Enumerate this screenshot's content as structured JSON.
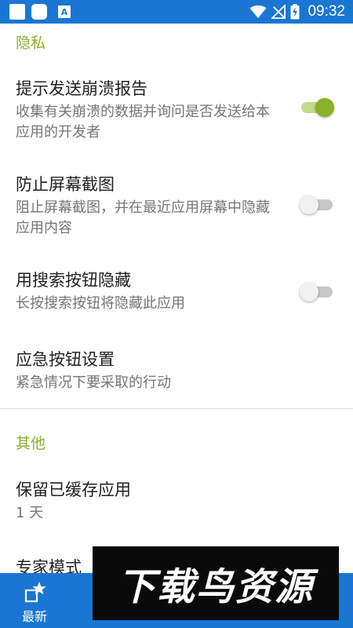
{
  "status_bar": {
    "time": "09:32",
    "notification_letter": "A",
    "icons": [
      "app-square-icon",
      "app-rounded-square-icon",
      "notification-a-icon",
      "wifi-icon",
      "no-signal-icon",
      "battery-charging-icon"
    ]
  },
  "sections": {
    "privacy": {
      "header": "隐私",
      "items": {
        "crash_report": {
          "title": "提示发送崩溃报告",
          "summary": "收集有关崩溃的数据并询问是否发送给本应用的开发者",
          "enabled": true
        },
        "prevent_screenshot": {
          "title": "防止屏幕截图",
          "summary": "阻止屏幕截图，并在最近应用屏幕中隐藏应用内容",
          "enabled": false
        },
        "hide_search": {
          "title": "用搜索按钮隐藏",
          "summary": "长按搜索按钮将隐藏此应用",
          "enabled": false
        },
        "panic_button": {
          "title": "应急按钮设置",
          "summary": "紧急情况下要采取的行动"
        }
      }
    },
    "other": {
      "header": "其他",
      "items": {
        "keep_cache": {
          "title": "保留已缓存应用",
          "summary": "1 天"
        },
        "expert_mode": {
          "title": "专家模式"
        }
      }
    }
  },
  "bottom_nav": {
    "latest_label": "最新"
  },
  "watermark": {
    "text": "下载鸟资源"
  },
  "colors": {
    "primary": "#1976d2",
    "accent": "#8bb02a",
    "text_primary": "#212121",
    "text_secondary": "#757575"
  }
}
